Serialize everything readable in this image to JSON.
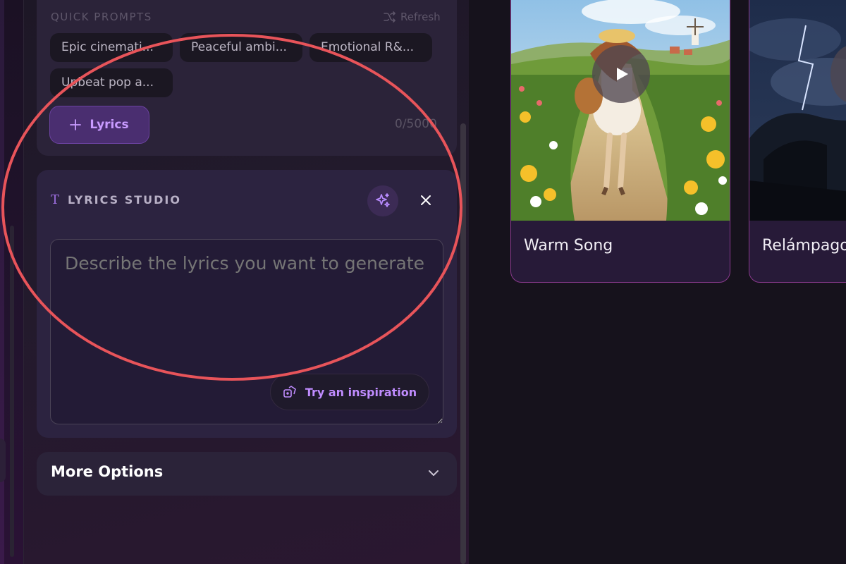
{
  "quick_prompts": {
    "label": "QUICK PROMPTS",
    "refresh_label": "Refresh",
    "chips": [
      "Epic cinemati...",
      "Peaceful ambi...",
      "Emotional R&...",
      "Upbeat pop a..."
    ]
  },
  "lyrics_button": {
    "label": "Lyrics"
  },
  "char_counter": "0/5000",
  "lyrics_studio": {
    "title": "LYRICS STUDIO",
    "placeholder": "Describe the lyrics you want to generate",
    "inspiration_label": "Try an inspiration"
  },
  "more_options": {
    "label": "More Options"
  },
  "songs": [
    {
      "title": "Warm Song"
    },
    {
      "title": "Relámpago"
    }
  ],
  "colors": {
    "accent": "#c99bff",
    "annotation": "#e8545a",
    "card_border": "#8a3a8e"
  },
  "icons": [
    "shuffle-icon",
    "plus-icon",
    "text-icon",
    "sparkle-icon",
    "close-icon",
    "dice-icon",
    "chevron-down-icon",
    "play-icon"
  ]
}
